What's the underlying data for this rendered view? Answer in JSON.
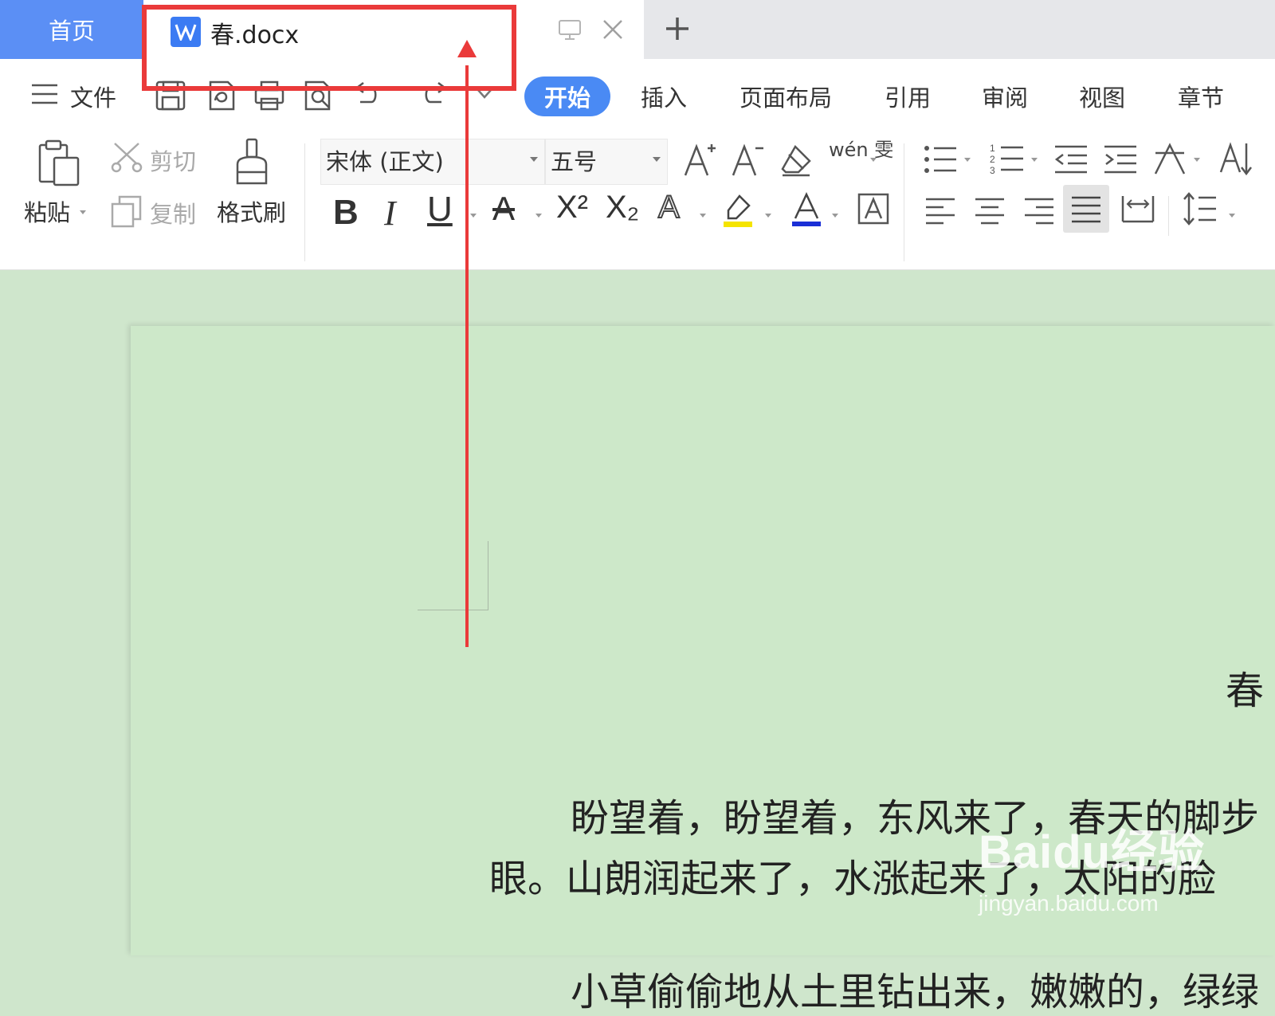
{
  "tabs": {
    "home": "首页",
    "document": "春.docx"
  },
  "menu": {
    "file": "文件",
    "tabs": [
      "开始",
      "插入",
      "页面布局",
      "引用",
      "审阅",
      "视图",
      "章节"
    ]
  },
  "clipboard": {
    "paste": "粘贴",
    "cut": "剪切",
    "copy": "复制",
    "format_painter": "格式刷"
  },
  "font": {
    "family": "宋体 (正文)",
    "size": "五号",
    "phonetic": "wén 雯"
  },
  "document": {
    "title": "春",
    "line1": "盼望着，盼望着，东风来了，春天的脚步",
    "line2": "眼。山朗润起来了，水涨起来了，太阳的脸",
    "line3": "小草偷偷地从土里钻出来，嫩嫩的，绿绿"
  },
  "colors": {
    "accent": "#4a8af4",
    "home_tab": "#5b8ff5",
    "page_bg": "#cde8c9",
    "annotation": "#ea3a3a",
    "highlight_yellow": "#f5e400",
    "font_color_blue": "#1a2fd6"
  },
  "watermark": {
    "logo": "Baidu经验",
    "url": "jingyan.baidu.com"
  },
  "icons": [
    "word-doc-icon",
    "screen-icon",
    "close-icon",
    "plus-icon",
    "hamburger-icon",
    "save-icon",
    "export-pdf-icon",
    "print-icon",
    "print-preview-icon",
    "undo-icon",
    "redo-icon",
    "more-icon",
    "paste-icon",
    "cut-icon",
    "copy-icon",
    "format-painter-icon",
    "bold-icon",
    "italic-icon",
    "underline-icon",
    "strikethrough-icon",
    "superscript-icon",
    "subscript-icon",
    "text-effect-icon",
    "highlight-icon",
    "font-color-icon",
    "char-border-icon",
    "bullets-icon",
    "numbering-icon",
    "decrease-indent-icon",
    "increase-indent-icon",
    "chinese-layout-icon",
    "sort-icon",
    "align-left-icon",
    "align-center-icon",
    "align-right-icon",
    "justify-icon",
    "distributed-icon",
    "line-spacing-icon"
  ]
}
